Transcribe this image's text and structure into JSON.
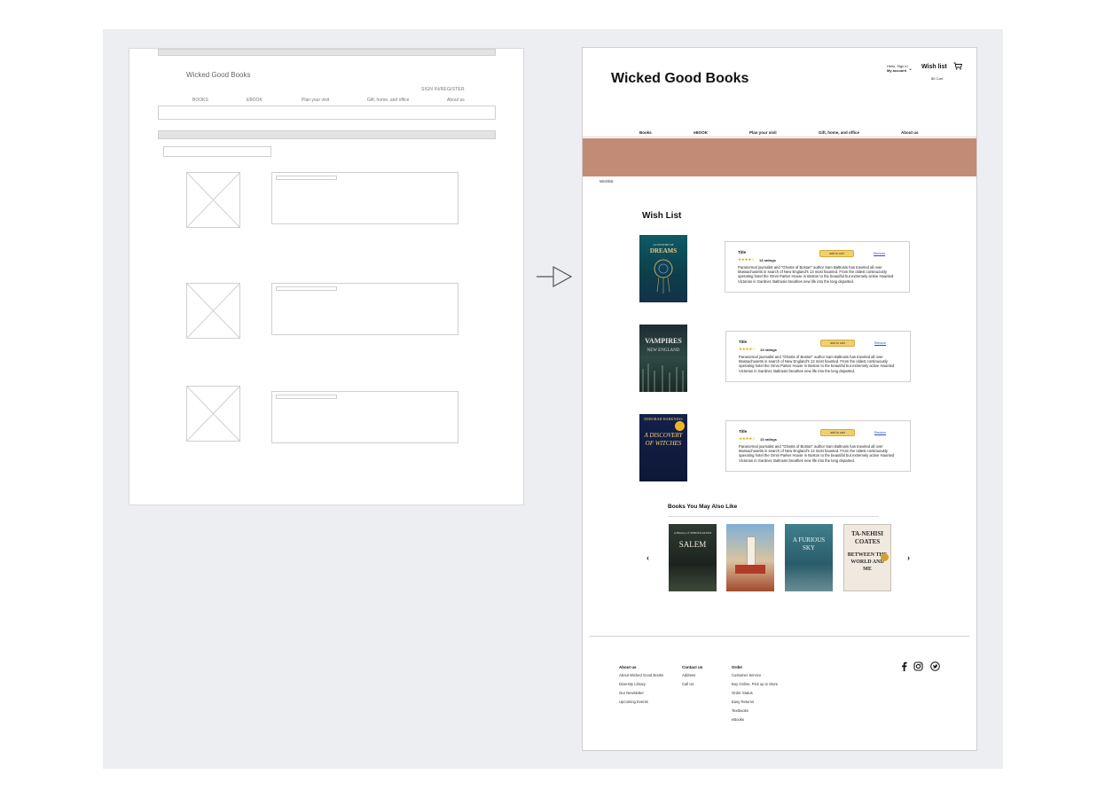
{
  "wireframe": {
    "logo": "Wicked Good Books",
    "signin": "SIGN IN/REGISTER",
    "nav": [
      "BOOKS",
      "EBOOK",
      "Plan your visit",
      "Gift, home, and office",
      "About us"
    ]
  },
  "mockup": {
    "brand": "Wicked Good Books",
    "account": {
      "line1": "Hello, Sign in",
      "line2": "My account"
    },
    "wishlist_link": "Wish list",
    "cart": "$0 Cart",
    "nav": [
      "Books",
      "eBOOK",
      "Plan your visit",
      "Gift, home, and office",
      "About us"
    ],
    "breadcrumb": "Wishlist",
    "wishlist_heading": "Wish List",
    "items": [
      {
        "cover_title": "DREAMS",
        "cover_sub": "A LITTLE BIT OF",
        "title": "Title",
        "stars": "★★★★☆",
        "ratings": "13 ratings",
        "button": "add to cart",
        "remove": "Remove",
        "description": "Paranormal journalist and \"Ghosts of Boston\" author Sam Baltrusis has traveled all over Massachusetts in search of New England's 13 most haunted. From the oldest continuously operating hotel the Omni Parker House in Boston to the beautiful but extremely active Haunted Victorian in Gardner, Baltrusis breathes new life into the long departed."
      },
      {
        "cover_title": "VAMPIRES",
        "cover_sub": "NEW ENGLAND",
        "title": "Title",
        "stars": "★★★★☆",
        "ratings": "13 ratings",
        "button": "add to cart",
        "remove": "Remove",
        "description": "Paranormal journalist and \"Ghosts of Boston\" author Sam Baltrusis has traveled all over Massachusetts in search of New England's 13 most haunted. From the oldest continuously operating hotel the Omni Parker House in Boston to the beautiful but extremely active Haunted Victorian in Gardner, Baltrusis breathes new life into the long departed."
      },
      {
        "cover_title": "A DISCOVERY OF WITCHES",
        "cover_sub": "DEBORAH HARKNESS",
        "title": "Title",
        "stars": "★★★★☆",
        "ratings": "13 ratings",
        "button": "add to cart",
        "remove": "Remove",
        "description": "Paranormal journalist and \"Ghosts of Boston\" author Sam Baltrusis has traveled all over Massachusetts in search of New England's 13 most haunted. From the oldest continuously operating hotel the Omni Parker House in Boston to the beautiful but extremely active Haunted Victorian in Gardner, Baltrusis breathes new life into the long departed."
      }
    ],
    "also_heading": "Books You May Also Like",
    "recommended": [
      {
        "title": "SALEM",
        "sub": "A History of SPIRITUALISM"
      },
      {
        "title": "LIGHTHOUSE",
        "sub": ""
      },
      {
        "title": "A FURIOUS SKY",
        "sub": ""
      },
      {
        "title": "TA-NEHISI COATES",
        "sub": "BETWEEN THE WORLD AND ME"
      }
    ],
    "prev": "‹",
    "next": "›",
    "footer": {
      "about": {
        "heading": "About us",
        "items": [
          "About Wicked Good Books",
          "Diversity Library",
          "Our Newsletter",
          "Upcoming Events"
        ]
      },
      "contact": {
        "heading": "Contact us",
        "items": [
          "Address",
          "Call Us"
        ]
      },
      "order": {
        "heading": "Order",
        "items": [
          "Customer Service",
          "Buy Online, Pick up in Store",
          "Order Status",
          "Easy Returns",
          "Textbooks",
          "eBooks"
        ]
      }
    },
    "social_icons": [
      "facebook-icon",
      "instagram-icon",
      "twitter-icon"
    ]
  },
  "colors": {
    "hero": "#c28b76",
    "button": "#f2cf6b",
    "link": "#2a4ad8",
    "stage": "#edeef1"
  }
}
